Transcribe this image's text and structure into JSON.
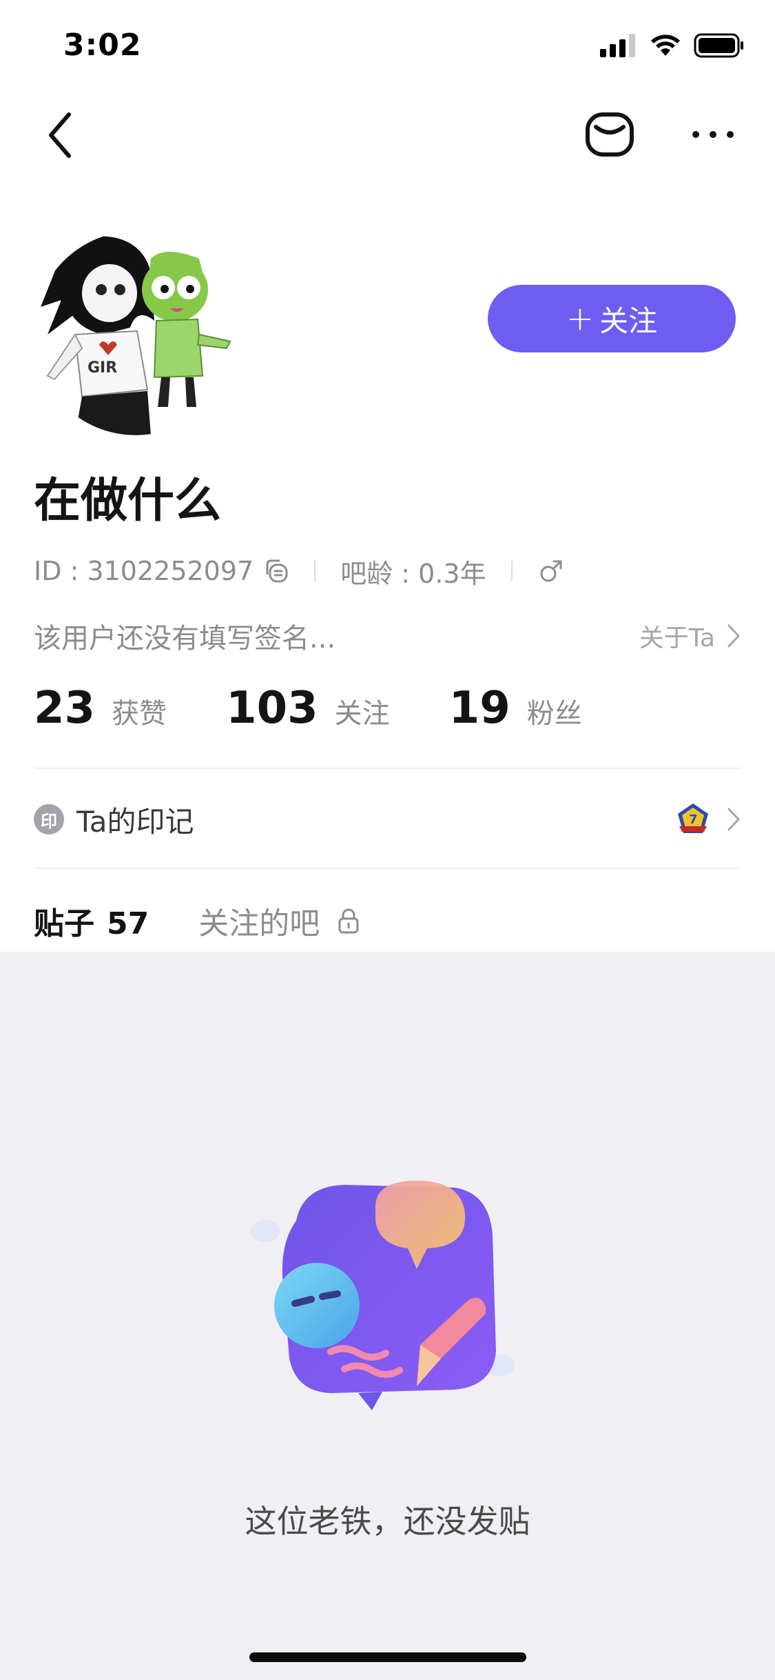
{
  "status_bar": {
    "time": "3:02"
  },
  "profile": {
    "username": "在做什么",
    "follow_button": "关注",
    "id_text": "ID : 3102252097",
    "age_text": "吧龄 : 0.3年",
    "gender": "male",
    "signature": "该用户还没有填写签名...",
    "about_link": "关于Ta"
  },
  "stats": [
    {
      "value": "23",
      "label": "获赞"
    },
    {
      "value": "103",
      "label": "关注"
    },
    {
      "value": "19",
      "label": "粉丝"
    }
  ],
  "marks": {
    "badge": "印",
    "label": "Ta的印记",
    "medal_number": "7"
  },
  "tabs": {
    "posts_label": "贴子",
    "posts_count": "57",
    "following_bars": "关注的吧"
  },
  "empty_state": {
    "message": "这位老铁，还没发贴"
  },
  "colors": {
    "accent": "#6f5df2",
    "content_bg": "#f0f0f4"
  }
}
